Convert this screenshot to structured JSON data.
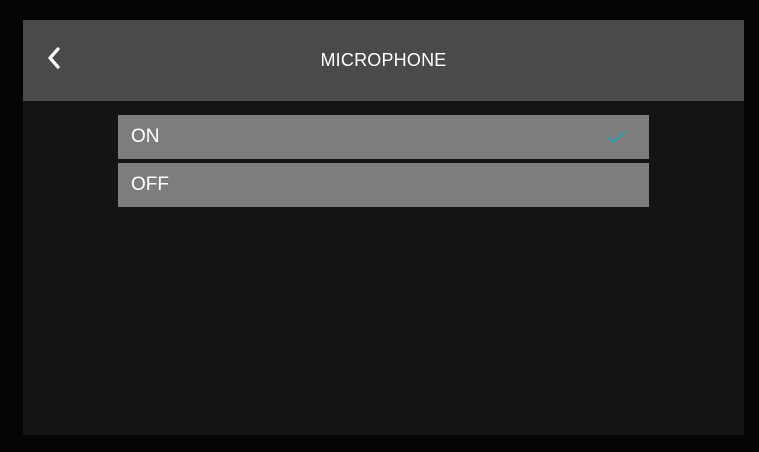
{
  "header": {
    "back_icon": "chevron-left-icon",
    "title": "MICROPHONE"
  },
  "options": [
    {
      "label": "ON",
      "selected": true
    },
    {
      "label": "OFF",
      "selected": false
    }
  ],
  "colors": {
    "header_bg": "#4a4a4a",
    "screen_bg": "#151414",
    "option_bg": "#7d7d7e",
    "check_accent": "#1fa3b3",
    "text": "#ffffff"
  }
}
